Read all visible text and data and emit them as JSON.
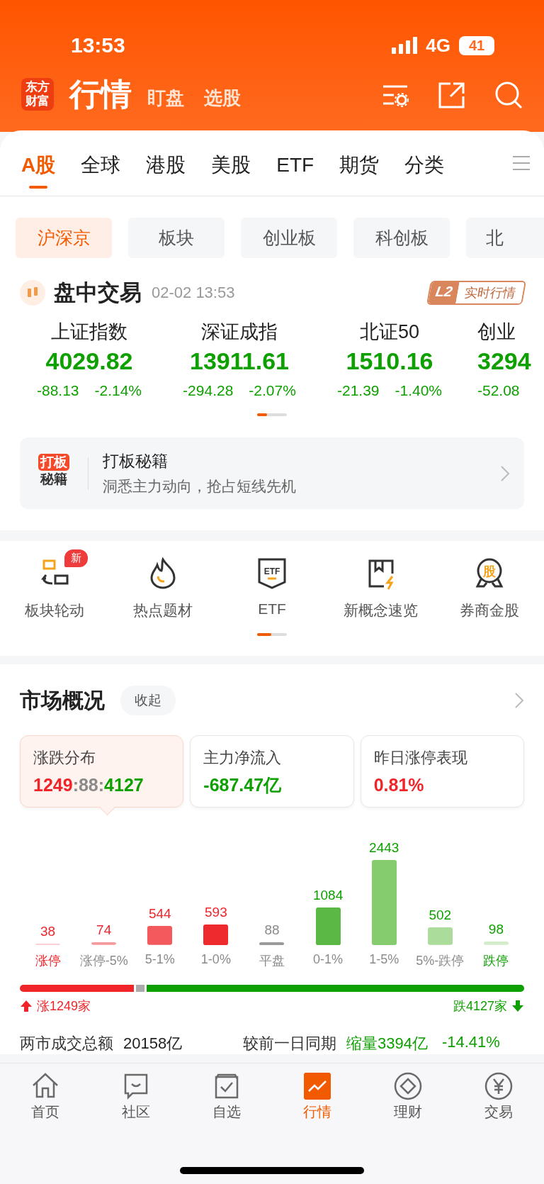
{
  "status_bar": {
    "time": "13:53",
    "network": "4G",
    "battery": "41"
  },
  "header": {
    "logo_lines": [
      "东方",
      "财富"
    ],
    "title": "行情",
    "links": [
      {
        "label": "盯盘"
      },
      {
        "label": "选股"
      }
    ]
  },
  "tabs": [
    {
      "label": "A股",
      "selected": true
    },
    {
      "label": "全球",
      "selected": false
    },
    {
      "label": "港股",
      "selected": false
    },
    {
      "label": "美股",
      "selected": false
    },
    {
      "label": "ETF",
      "selected": false
    },
    {
      "label": "期货",
      "selected": false
    },
    {
      "label": "分类",
      "selected": false
    }
  ],
  "chips": [
    {
      "label": "沪深京",
      "selected": true
    },
    {
      "label": "板块",
      "selected": false
    },
    {
      "label": "创业板",
      "selected": false
    },
    {
      "label": "科创板",
      "selected": false
    },
    {
      "label": "北",
      "selected": false
    }
  ],
  "session": {
    "title": "盘中交易",
    "time": "02-02 13:53",
    "badge_tag": "L2",
    "badge_label": "实时行情"
  },
  "indices": [
    {
      "name": "上证指数",
      "value": "4029.82",
      "change": "-88.13",
      "percent": "-2.14%"
    },
    {
      "name": "深证成指",
      "value": "13911.61",
      "change": "-294.28",
      "percent": "-2.07%"
    },
    {
      "name": "北证50",
      "value": "1510.16",
      "change": "-21.39",
      "percent": "-1.40%"
    },
    {
      "name": "创业",
      "value": "3294",
      "change": "-52.08"
    }
  ],
  "banner": {
    "icon_lines": [
      "打板",
      "秘籍"
    ],
    "title": "打板秘籍",
    "subtitle": "洞悉主力动向，抢占短线先机"
  },
  "shortcuts": [
    {
      "label": "板块轮动",
      "kind": "rotate",
      "badge": "新"
    },
    {
      "label": "热点题材",
      "kind": "flame"
    },
    {
      "label": "ETF",
      "kind": "etf",
      "icon_text": "ETF"
    },
    {
      "label": "新概念速览",
      "kind": "book"
    },
    {
      "label": "券商金股",
      "kind": "medal",
      "icon_text": "股"
    }
  ],
  "overview": {
    "title": "市场概况",
    "toggle": "收起",
    "cards": [
      {
        "label": "涨跌分布",
        "selected": true,
        "parts": [
          {
            "text": "1249",
            "color": "#f0252a"
          },
          {
            "text": ":",
            "color": "#8a8a8a"
          },
          {
            "text": "88",
            "color": "#8a8a8a"
          },
          {
            "text": ":",
            "color": "#8a8a8a"
          },
          {
            "text": "4127",
            "color": "#0ea000"
          }
        ]
      },
      {
        "label": "主力净流入",
        "selected": false,
        "parts": [
          {
            "text": "-687.47亿",
            "color": "#0ea000"
          }
        ]
      },
      {
        "label": "昨日涨停表现",
        "selected": false,
        "parts": [
          {
            "text": "0.81%",
            "color": "#f0252a"
          }
        ]
      }
    ],
    "chart_data": {
      "type": "bar",
      "categories": [
        "涨停",
        "涨停-5%",
        "5-1%",
        "1-0%",
        "平盘",
        "0-1%",
        "1-5%",
        "5%-跌停",
        "跌停"
      ],
      "values": [
        38,
        74,
        544,
        593,
        88,
        1084,
        2443,
        502,
        98
      ],
      "colors": [
        "#fbc9cb",
        "#f59a9c",
        "#f25a5d",
        "#ef2a2d",
        "#9a9a9a",
        "#5cb844",
        "#84cc6e",
        "#abdc9c",
        "#d3edca"
      ],
      "data_labels": true
    },
    "breadth": {
      "up_label": "涨1249家",
      "down_label": "跌4127家"
    },
    "stats": [
      {
        "label": "两市成交总额",
        "value": "20158亿",
        "color": "#222222"
      },
      {
        "label": "较前一日同期",
        "value": "缩量3394亿",
        "extra": "-14.41%",
        "color": "#0ea000"
      }
    ]
  },
  "nav": [
    {
      "label": "首页",
      "kind": "home",
      "selected": false
    },
    {
      "label": "社区",
      "kind": "chat",
      "selected": false
    },
    {
      "label": "自选",
      "kind": "check",
      "selected": false
    },
    {
      "label": "行情",
      "kind": "chart",
      "selected": true
    },
    {
      "label": "理财",
      "kind": "diamond",
      "selected": false
    },
    {
      "label": "交易",
      "kind": "yen",
      "selected": false
    }
  ]
}
